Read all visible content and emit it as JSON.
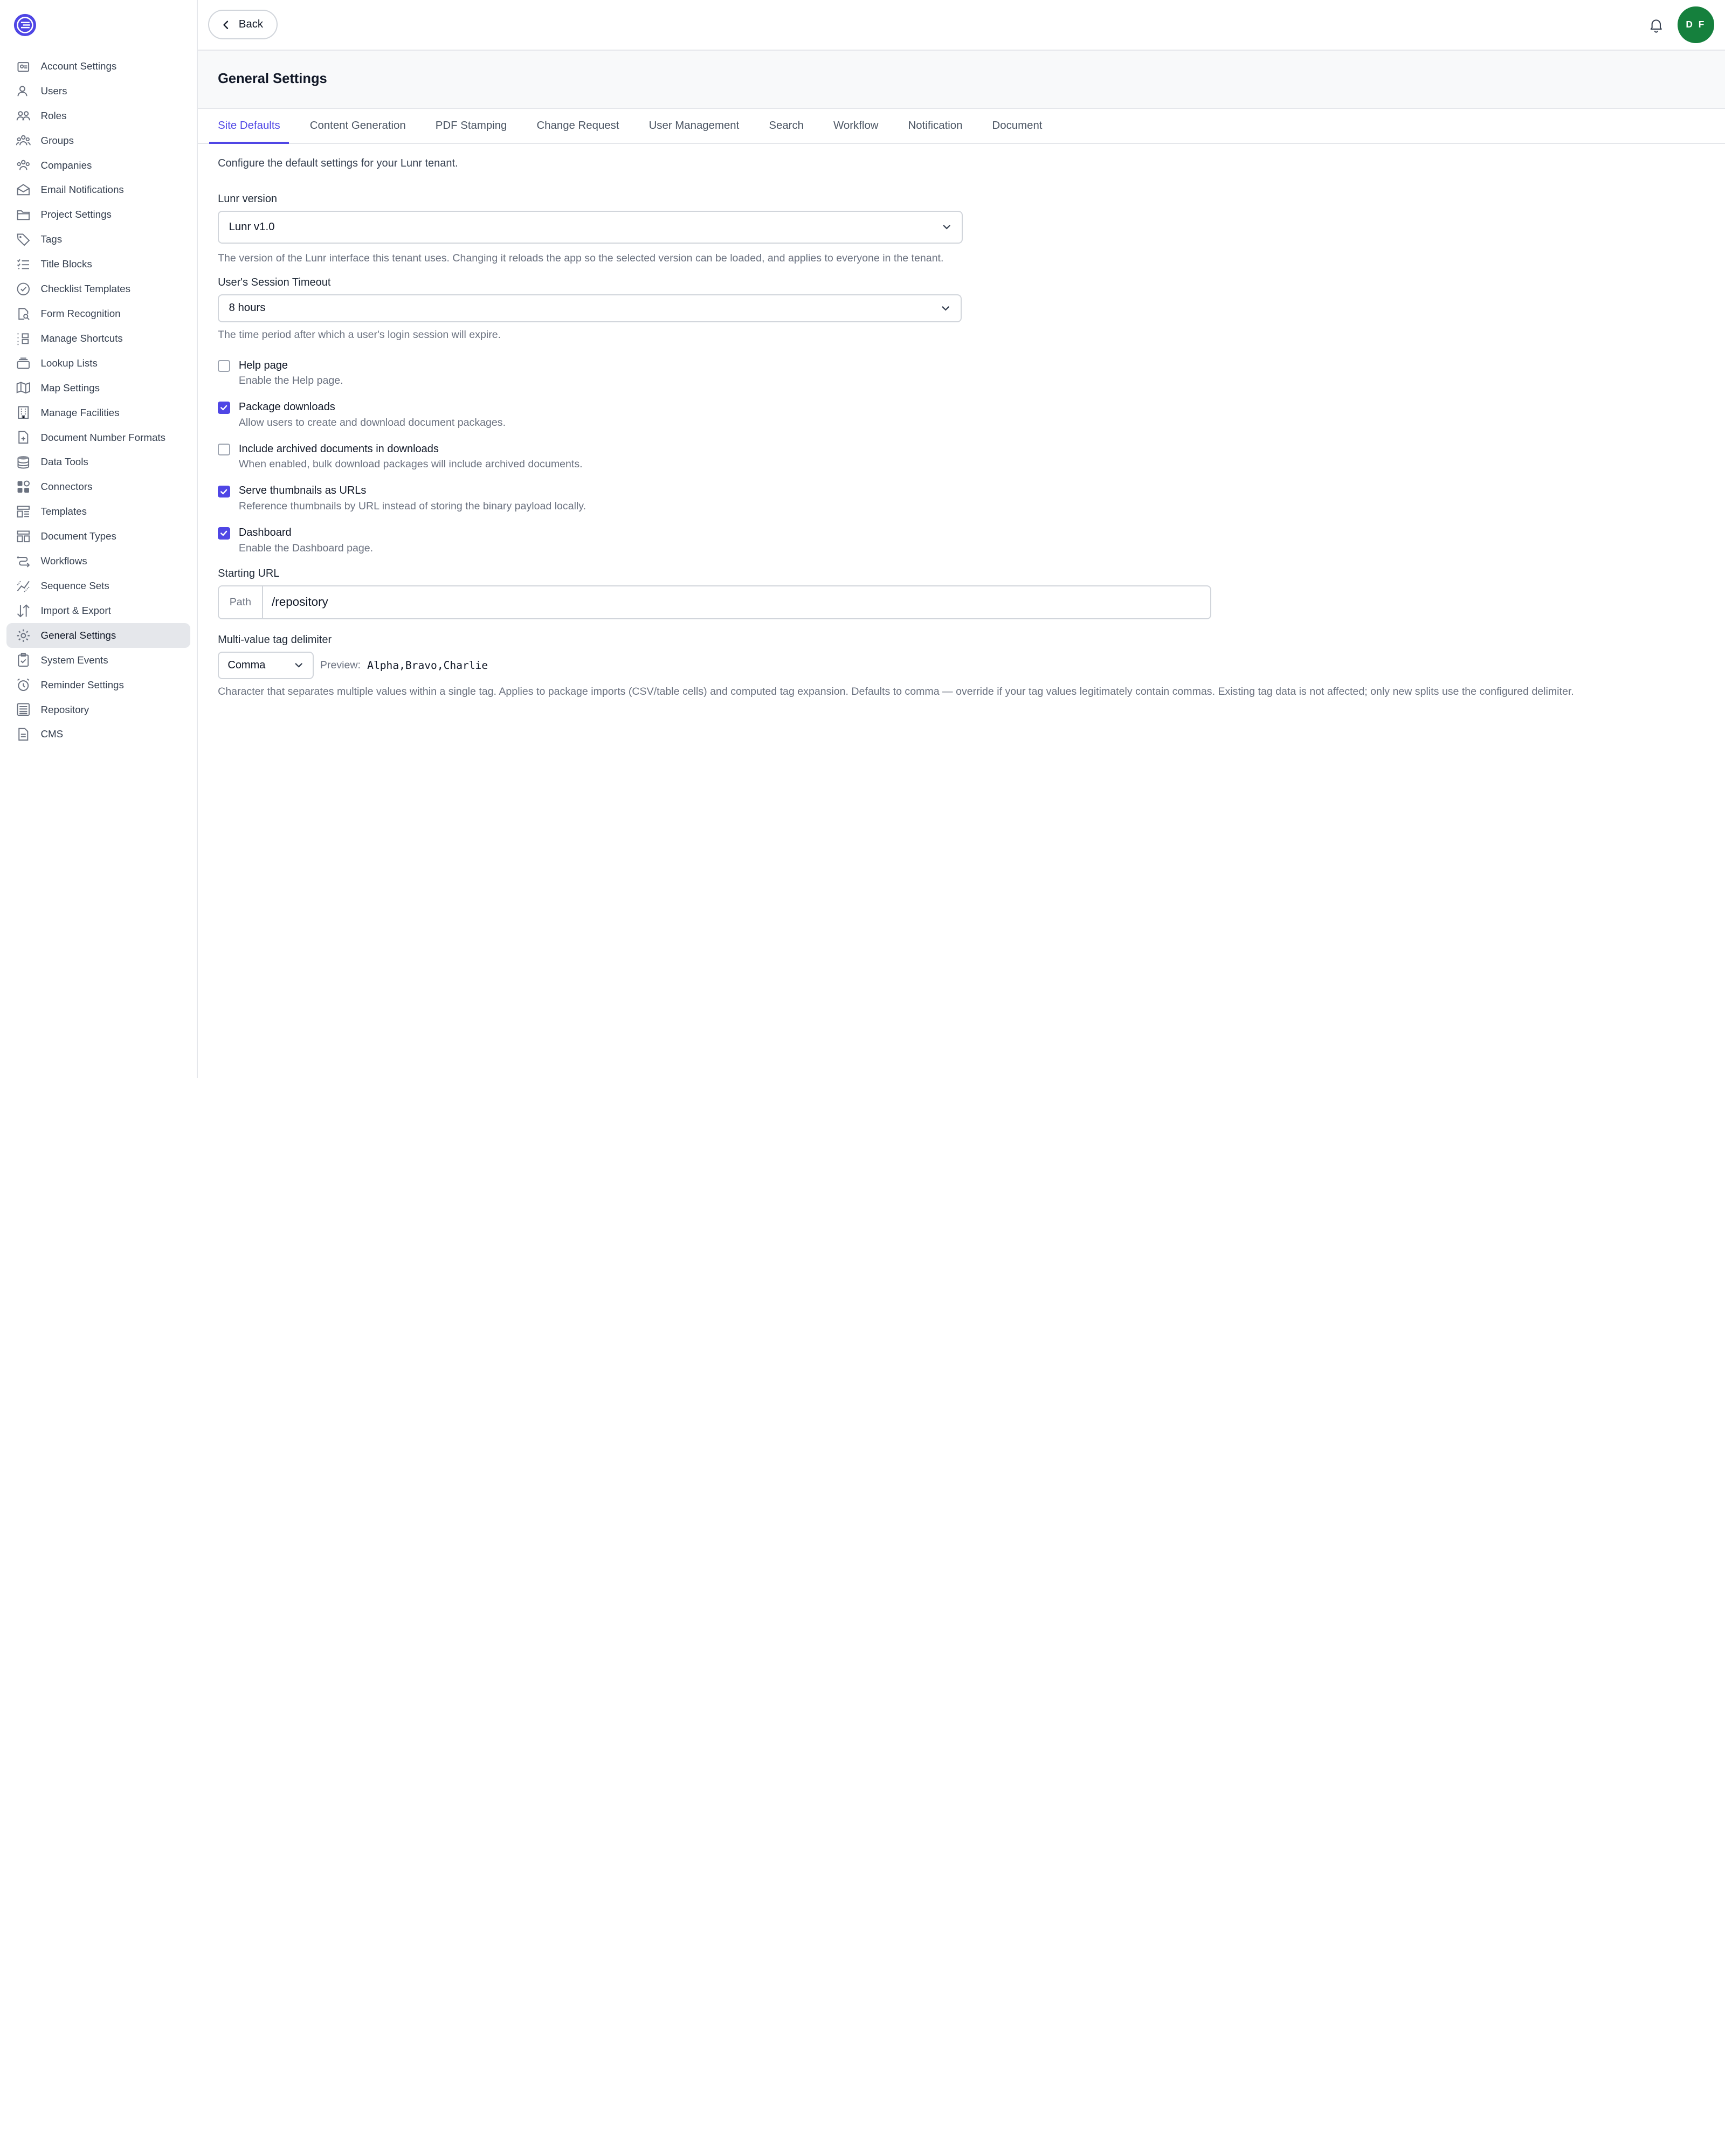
{
  "sidebar": {
    "items": [
      {
        "label": "Account Settings",
        "icon": "account-settings-icon"
      },
      {
        "label": "Users",
        "icon": "users-icon"
      },
      {
        "label": "Roles",
        "icon": "roles-icon"
      },
      {
        "label": "Groups",
        "icon": "groups-icon"
      },
      {
        "label": "Companies",
        "icon": "companies-icon"
      },
      {
        "label": "Email Notifications",
        "icon": "email-icon"
      },
      {
        "label": "Project Settings",
        "icon": "folder-icon"
      },
      {
        "label": "Tags",
        "icon": "tag-icon"
      },
      {
        "label": "Title Blocks",
        "icon": "list-icon"
      },
      {
        "label": "Checklist Templates",
        "icon": "check-circle-icon"
      },
      {
        "label": "Form Recognition",
        "icon": "form-search-icon"
      },
      {
        "label": "Manage Shortcuts",
        "icon": "shortcuts-icon"
      },
      {
        "label": "Lookup Lists",
        "icon": "stack-icon"
      },
      {
        "label": "Map Settings",
        "icon": "map-icon"
      },
      {
        "label": "Manage Facilities",
        "icon": "building-icon"
      },
      {
        "label": "Document Number Formats",
        "icon": "file-plus-icon"
      },
      {
        "label": "Data Tools",
        "icon": "database-icon"
      },
      {
        "label": "Connectors",
        "icon": "connectors-icon"
      },
      {
        "label": "Templates",
        "icon": "templates-icon"
      },
      {
        "label": "Document Types",
        "icon": "document-types-icon"
      },
      {
        "label": "Workflows",
        "icon": "workflow-icon"
      },
      {
        "label": "Sequence Sets",
        "icon": "sequence-icon"
      },
      {
        "label": "Import & Export",
        "icon": "import-export-icon"
      },
      {
        "label": "General Settings",
        "icon": "gear-icon",
        "active": true
      },
      {
        "label": "System Events",
        "icon": "clipboard-check-icon"
      },
      {
        "label": "Reminder Settings",
        "icon": "alarm-icon"
      },
      {
        "label": "Repository",
        "icon": "repository-icon"
      },
      {
        "label": "CMS",
        "icon": "file-text-icon"
      }
    ]
  },
  "topbar": {
    "back_label": "Back",
    "avatar_initials": "D F",
    "avatar_color": "#15803d"
  },
  "page": {
    "title": "General Settings"
  },
  "tabs": [
    {
      "label": "Site Defaults",
      "active": true
    },
    {
      "label": "Content Generation"
    },
    {
      "label": "PDF Stamping"
    },
    {
      "label": "Change Request"
    },
    {
      "label": "User Management"
    },
    {
      "label": "Search"
    },
    {
      "label": "Workflow"
    },
    {
      "label": "Notification"
    },
    {
      "label": "Document"
    }
  ],
  "form": {
    "intro": "Configure the default settings for your Lunr tenant.",
    "version": {
      "label": "Lunr version",
      "value": "Lunr v1.0",
      "help": "The version of the Lunr interface this tenant uses. Changing it reloads the app so the selected version can be loaded, and applies to everyone in the tenant."
    },
    "session": {
      "label": "User's Session Timeout",
      "value": "8 hours",
      "help": "The time period after which a user's login session will expire."
    },
    "checkboxes": [
      {
        "title": "Help page",
        "desc": "Enable the Help page.",
        "checked": false
      },
      {
        "title": "Package downloads",
        "desc": "Allow users to create and download document packages.",
        "checked": true
      },
      {
        "title": "Include archived documents in downloads",
        "desc": "When enabled, bulk download packages will include archived documents.",
        "checked": false
      },
      {
        "title": "Serve thumbnails as URLs",
        "desc": "Reference thumbnails by URL instead of storing the binary payload locally.",
        "checked": true
      },
      {
        "title": "Dashboard",
        "desc": "Enable the Dashboard page.",
        "checked": true
      }
    ],
    "starting_url": {
      "label": "Starting URL",
      "prefix": "Path",
      "value": "/repository"
    },
    "delimiter": {
      "label": "Multi-value tag delimiter",
      "value": "Comma",
      "preview_label": "Preview:",
      "preview_value": "Alpha,Bravo,Charlie",
      "help": "Character that separates multiple values within a single tag. Applies to package imports (CSV/table cells) and computed tag expansion. Defaults to comma — override if your tag values legitimately contain commas. Existing tag data is not affected; only new splits use the configured delimiter."
    }
  },
  "colors": {
    "accent": "#4f46e5",
    "logo": "#4f46e5"
  }
}
